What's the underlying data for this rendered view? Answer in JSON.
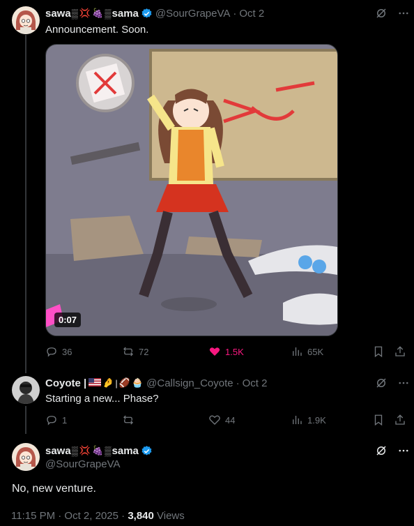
{
  "tweet1": {
    "display_name": "sawa",
    "display_name_suffix": "sama",
    "handle": "@SourGrapeVA",
    "separator": "·",
    "date": "Oct 2",
    "text": "Announcement. Soon.",
    "video_duration": "0:07",
    "actions": {
      "replies": "36",
      "reposts": "72",
      "likes": "1.5K",
      "views": "65K"
    }
  },
  "tweet2": {
    "display_name": "Coyote |",
    "handle": "@Callsign_Coyote",
    "separator": "·",
    "date": "Oct 2",
    "text": "Starting a new... Phase?",
    "actions": {
      "replies": "1",
      "reposts": "",
      "likes": "44",
      "views": "1.9K"
    }
  },
  "focus_tweet": {
    "display_name": "sawa",
    "display_name_suffix": "sama",
    "handle": "@SourGrapeVA",
    "text": "No, new venture.",
    "timestamp": "11:15 PM · Oct 2, 2025 · ",
    "views_count": "3,840",
    "views_label": " Views"
  },
  "colors": {
    "accent": "#1d9bf0",
    "like": "#f91880",
    "muted": "#71767b",
    "text": "#e7e9ea",
    "background": "#000000"
  },
  "icons": [
    "verified-icon",
    "grok-icon",
    "more-icon",
    "reply-icon",
    "repost-icon",
    "heart-icon",
    "views-icon",
    "bookmark-icon",
    "share-icon",
    "flag-us-icon",
    "emoji-icons"
  ]
}
